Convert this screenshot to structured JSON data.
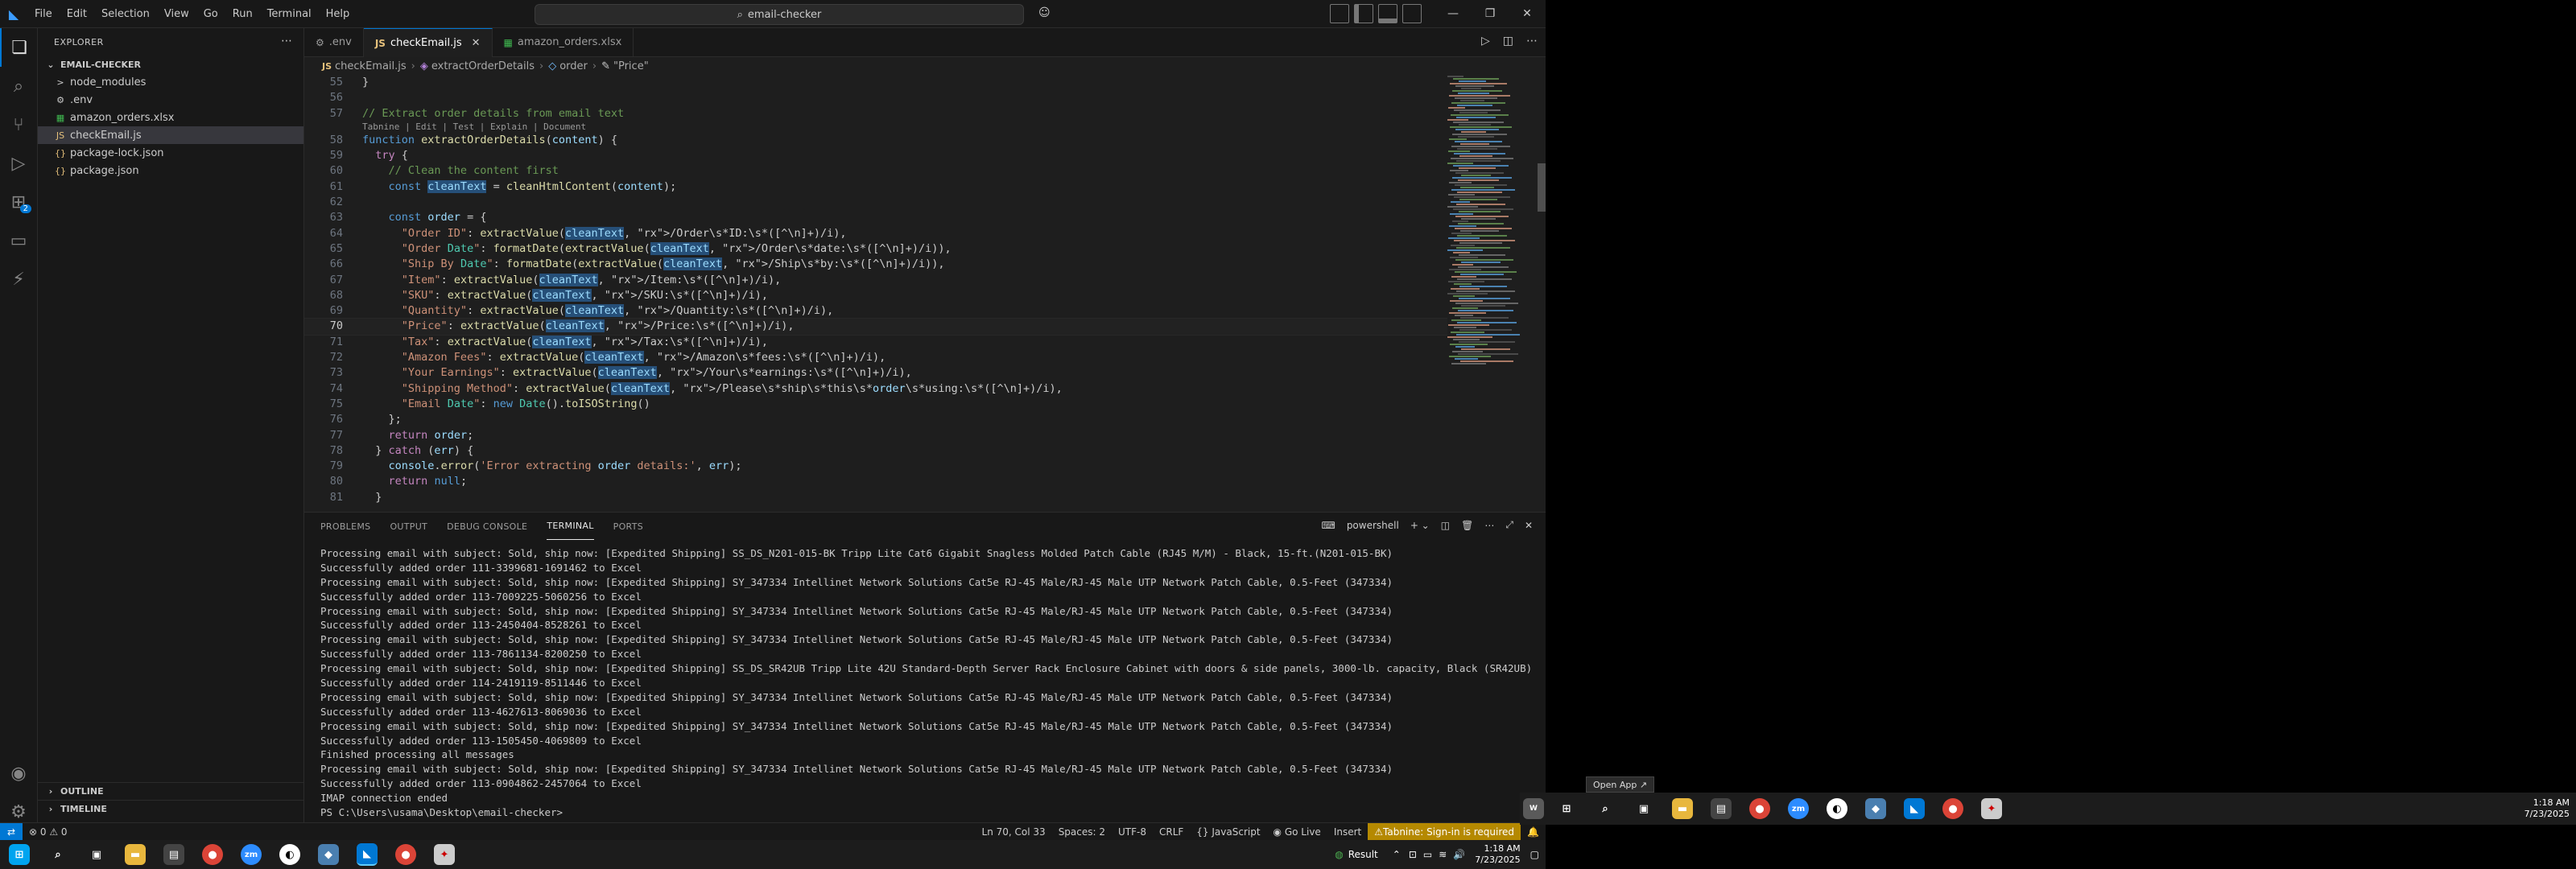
{
  "titlebar": {
    "menus": [
      "File",
      "Edit",
      "Selection",
      "View",
      "Go",
      "Run",
      "Terminal",
      "Help"
    ],
    "search": "email-checker"
  },
  "sidebar": {
    "title": "EXPLORER",
    "folder": "EMAIL-CHECKER",
    "items": [
      {
        "name": "node_modules",
        "icon": ">",
        "color": "#cccccc"
      },
      {
        "name": ".env",
        "icon": "⚙",
        "color": "#cccccc"
      },
      {
        "name": "amazon_orders.xlsx",
        "icon": "▦",
        "color": "#3fb950"
      },
      {
        "name": "checkEmail.js",
        "icon": "JS",
        "color": "#e5c07b"
      },
      {
        "name": "package-lock.json",
        "icon": "{}",
        "color": "#e5c07b"
      },
      {
        "name": "package.json",
        "icon": "{}",
        "color": "#e5c07b"
      }
    ],
    "outline": "OUTLINE",
    "timeline": "TIMELINE"
  },
  "activity": {
    "extensions_badge": "2"
  },
  "tabs": [
    {
      "label": ".env",
      "icon": "⚙"
    },
    {
      "label": "checkEmail.js",
      "icon": "JS"
    },
    {
      "label": "amazon_orders.xlsx",
      "icon": "▦"
    }
  ],
  "breadcrumb": [
    "checkEmail.js",
    "extractOrderDetails",
    "order",
    "\"Price\""
  ],
  "code": {
    "codelens": "Tabnine | Edit | Test | Explain | Document",
    "lines": [
      {
        "n": "55",
        "text": "}"
      },
      {
        "n": "56",
        "text": ""
      },
      {
        "n": "57",
        "text": "// Extract order details from email text"
      },
      {
        "n": "58",
        "text": "function extractOrderDetails(content) {"
      },
      {
        "n": "59",
        "text": "  try {"
      },
      {
        "n": "60",
        "text": "    // Clean the content first"
      },
      {
        "n": "61",
        "text": "    const cleanText = cleanHtmlContent(content);"
      },
      {
        "n": "62",
        "text": ""
      },
      {
        "n": "63",
        "text": "    const order = {"
      },
      {
        "n": "64",
        "text": "      \"Order ID\": extractValue(cleanText, /Order\\s*ID:\\s*([^\\n]+)/i),"
      },
      {
        "n": "65",
        "text": "      \"Order Date\": formatDate(extractValue(cleanText, /Order\\s*date:\\s*([^\\n]+)/i)),"
      },
      {
        "n": "66",
        "text": "      \"Ship By Date\": formatDate(extractValue(cleanText, /Ship\\s*by:\\s*([^\\n]+)/i)),"
      },
      {
        "n": "67",
        "text": "      \"Item\": extractValue(cleanText, /Item:\\s*([^\\n]+)/i),"
      },
      {
        "n": "68",
        "text": "      \"SKU\": extractValue(cleanText, /SKU:\\s*([^\\n]+)/i),"
      },
      {
        "n": "69",
        "text": "      \"Quantity\": extractValue(cleanText, /Quantity:\\s*([^\\n]+)/i),"
      },
      {
        "n": "70",
        "text": "      \"Price\": extractValue(cleanText, /Price:\\s*([^\\n]+)/i),"
      },
      {
        "n": "71",
        "text": "      \"Tax\": extractValue(cleanText, /Tax:\\s*([^\\n]+)/i),"
      },
      {
        "n": "72",
        "text": "      \"Amazon Fees\": extractValue(cleanText, /Amazon\\s*fees:\\s*([^\\n]+)/i),"
      },
      {
        "n": "73",
        "text": "      \"Your Earnings\": extractValue(cleanText, /Your\\s*earnings:\\s*([^\\n]+)/i),"
      },
      {
        "n": "74",
        "text": "      \"Shipping Method\": extractValue(cleanText, /Please\\s*ship\\s*this\\s*order\\s*using:\\s*([^\\n]+)/i),"
      },
      {
        "n": "75",
        "text": "      \"Email Date\": new Date().toISOString()"
      },
      {
        "n": "76",
        "text": "    };"
      },
      {
        "n": "77",
        "text": "    return order;"
      },
      {
        "n": "78",
        "text": "  } catch (err) {"
      },
      {
        "n": "79",
        "text": "    console.error('Error extracting order details:', err);"
      },
      {
        "n": "80",
        "text": "    return null;"
      },
      {
        "n": "81",
        "text": "  }"
      }
    ]
  },
  "panel": {
    "tabs": [
      "PROBLEMS",
      "OUTPUT",
      "DEBUG CONSOLE",
      "TERMINAL",
      "PORTS"
    ],
    "shell": "powershell",
    "terminal": [
      "Processing email with subject: Sold, ship now: [Expedited Shipping] SS_DS_N201-015-BK Tripp Lite Cat6 Gigabit Snagless Molded Patch Cable (RJ45 M/M) - Black, 15-ft.(N201-015-BK)",
      "Successfully added order 111-3399681-1691462 to Excel",
      "Processing email with subject: Sold, ship now: [Expedited Shipping] SY_347334 Intellinet Network Solutions Cat5e RJ-45 Male/RJ-45 Male UTP Network Patch Cable, 0.5-Feet (347334)",
      "Successfully added order 113-7009225-5060256 to Excel",
      "Processing email with subject: Sold, ship now: [Expedited Shipping] SY_347334 Intellinet Network Solutions Cat5e RJ-45 Male/RJ-45 Male UTP Network Patch Cable, 0.5-Feet (347334)",
      "Successfully added order 113-2450404-8528261 to Excel",
      "Processing email with subject: Sold, ship now: [Expedited Shipping] SY_347334 Intellinet Network Solutions Cat5e RJ-45 Male/RJ-45 Male UTP Network Patch Cable, 0.5-Feet (347334)",
      "Successfully added order 113-7861134-8200250 to Excel",
      "Processing email with subject: Sold, ship now: [Expedited Shipping] SS_DS_SR42UB Tripp Lite 42U Standard-Depth Server Rack Enclosure Cabinet with doors & side panels, 3000-lb. capacity, Black (SR42UB)",
      "Successfully added order 114-2419119-8511446 to Excel",
      "Processing email with subject: Sold, ship now: [Expedited Shipping] SY_347334 Intellinet Network Solutions Cat5e RJ-45 Male/RJ-45 Male UTP Network Patch Cable, 0.5-Feet (347334)",
      "Successfully added order 113-4627613-8069036 to Excel",
      "Processing email with subject: Sold, ship now: [Expedited Shipping] SY_347334 Intellinet Network Solutions Cat5e RJ-45 Male/RJ-45 Male UTP Network Patch Cable, 0.5-Feet (347334)",
      "Successfully added order 113-1505450-4069809 to Excel",
      "Finished processing all messages",
      "Processing email with subject: Sold, ship now: [Expedited Shipping] SY_347334 Intellinet Network Solutions Cat5e RJ-45 Male/RJ-45 Male UTP Network Patch Cable, 0.5-Feet (347334)",
      "Successfully added order 113-0904862-2457064 to Excel",
      "IMAP connection ended",
      "PS C:\\Users\\usama\\Desktop\\email-checker> "
    ]
  },
  "status": {
    "errors": "0",
    "warnings": "0",
    "position": "Ln 70, Col 33",
    "spaces": "Spaces: 2",
    "encoding": "UTF-8",
    "eol": "CRLF",
    "language": "{} JavaScript",
    "golive": "Go Live",
    "insert": "Insert",
    "tabnine": "Tabnine: Sign-in is required"
  },
  "taskbar": {
    "tray_label": "Result",
    "time": "1:18 AM",
    "date": "7/23/2025"
  },
  "taskbar_right": {
    "tooltip": "Open App",
    "time": "1:18 AM",
    "date": "7/23/2025"
  }
}
